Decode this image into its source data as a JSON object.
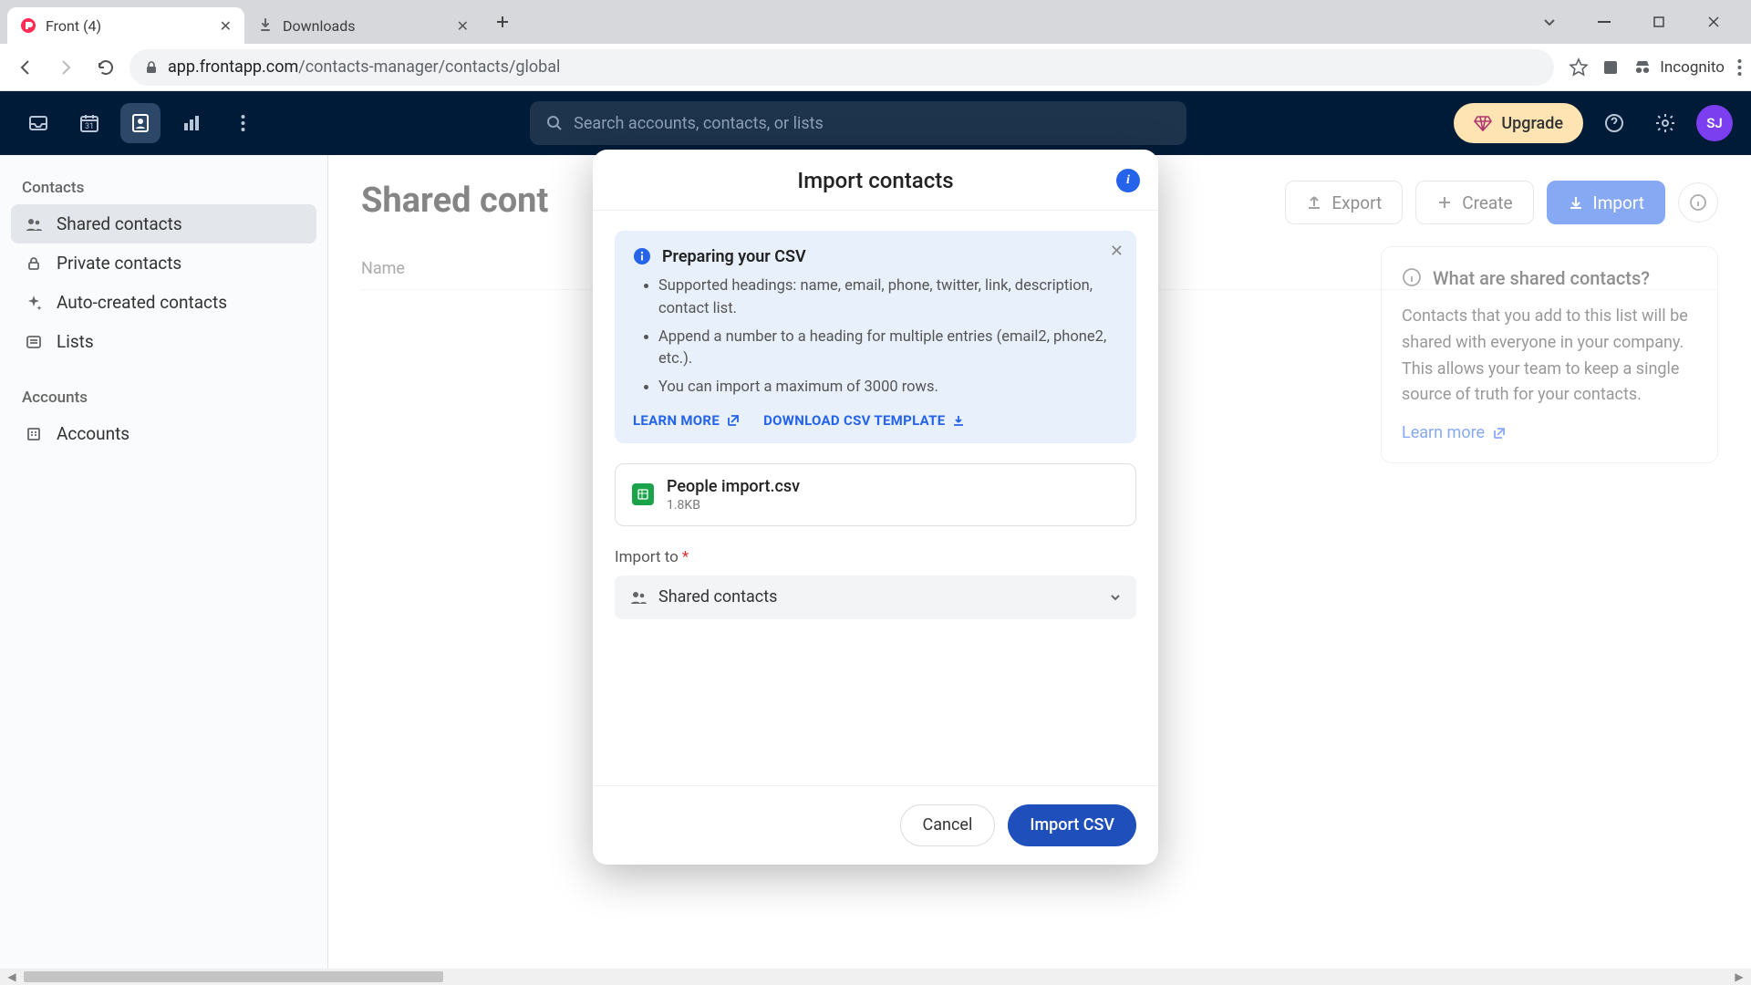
{
  "browser": {
    "tabs": [
      {
        "title": "Front (4)",
        "active": true
      },
      {
        "title": "Downloads",
        "active": false
      }
    ],
    "url_lock": true,
    "url_domain": "app.frontapp.com",
    "url_path": "/contacts-manager/contacts/global",
    "incognito_label": "Incognito"
  },
  "header": {
    "search_placeholder": "Search accounts, contacts, or lists",
    "upgrade_label": "Upgrade",
    "avatar_initials": "SJ"
  },
  "sidebar": {
    "section_contacts": "Contacts",
    "items_contacts": [
      "Shared contacts",
      "Private contacts",
      "Auto-created contacts",
      "Lists"
    ],
    "section_accounts": "Accounts",
    "items_accounts": [
      "Accounts"
    ]
  },
  "main": {
    "title": "Shared cont",
    "col_name": "Name",
    "actions": {
      "export": "Export",
      "create": "Create",
      "import": "Import"
    },
    "infocard": {
      "title": "What are shared contacts?",
      "body": "Contacts that you add to this list will be shared with everyone in your company. This allows your team to keep a single source of truth for your contacts.",
      "learn": "Learn more"
    }
  },
  "modal": {
    "title": "Import contacts",
    "tip_title": "Preparing your CSV",
    "tip_items": [
      "Supported headings: name, email, phone, twitter, link, description, contact list.",
      "Append a number to a heading for multiple entries (email2, phone2, etc.).",
      "You can import a maximum of 3000 rows."
    ],
    "learn_more": "LEARN MORE",
    "download_tpl": "DOWNLOAD CSV TEMPLATE",
    "file_name": "People import.csv",
    "file_size": "1.8KB",
    "import_to_label": "Import to",
    "import_to_value": "Shared contacts",
    "cancel": "Cancel",
    "confirm": "Import CSV"
  }
}
